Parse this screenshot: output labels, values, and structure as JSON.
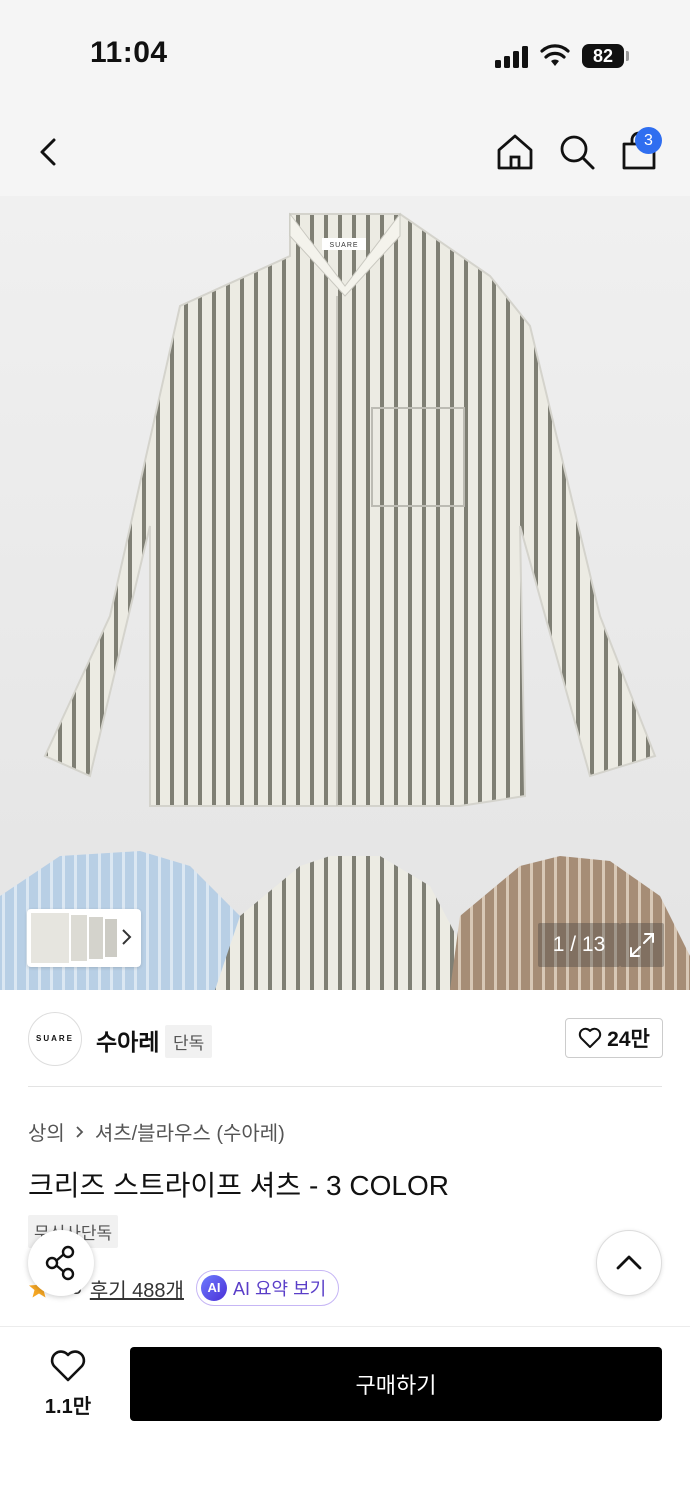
{
  "status_bar": {
    "time": "11:04",
    "battery": "82"
  },
  "nav": {
    "cart_count": "3"
  },
  "gallery": {
    "counter": "1 / 13",
    "main_image": "striped-shirt-photo",
    "logo_text": "SUARE"
  },
  "brand": {
    "logo_text": "SUARE",
    "name": "수아레",
    "tag": "단독",
    "likes": "24만"
  },
  "breadcrumb": {
    "category": "상의",
    "subcategory": "셔츠/블라우스 (수아레)"
  },
  "product": {
    "title": "크리즈 스트라이프 셔츠 - 3 COLOR",
    "badge": "무신사단독",
    "rating": "4.8",
    "reviews": "후기 488개",
    "ai_badge": "AI",
    "ai_label": "AI 요약 보기"
  },
  "bottom": {
    "wish_count": "1.1만",
    "buy_label": "구매하기"
  },
  "colors": {
    "accent": "#2f6ef0",
    "star": "#f5a623",
    "ai": "#5a3ec8"
  }
}
